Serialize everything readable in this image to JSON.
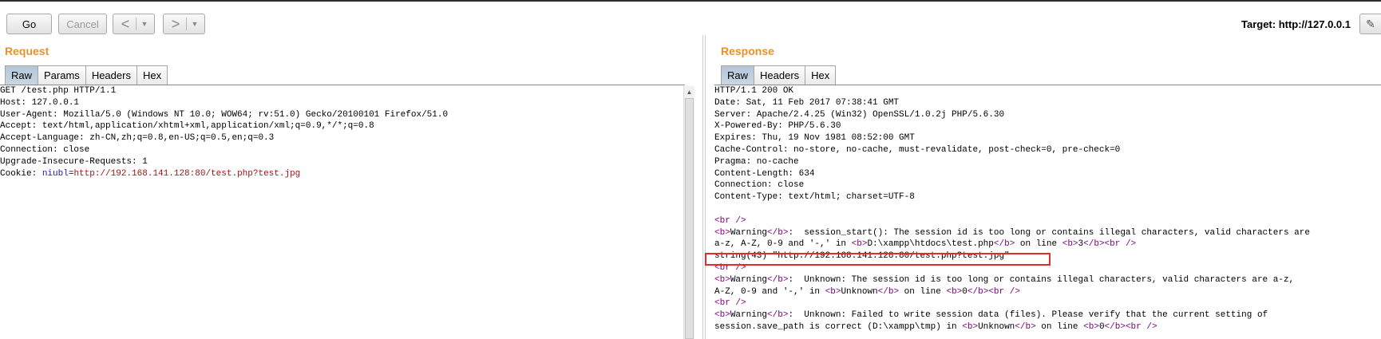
{
  "toolbar": {
    "go": "Go",
    "cancel": "Cancel",
    "back_arrow": "<",
    "forward_arrow": ">",
    "dropdown_arrow": "▼",
    "target_label": "Target: http://127.0.0.1"
  },
  "request": {
    "title": "Request",
    "tabs": [
      "Raw",
      "Params",
      "Headers",
      "Hex"
    ],
    "active_tab": "Raw",
    "lines": [
      "GET /test.php HTTP/1.1",
      "Host: 127.0.0.1",
      "User-Agent: Mozilla/5.0 (Windows NT 10.0; WOW64; rv:51.0) Gecko/20100101 Firefox/51.0",
      "Accept: text/html,application/xhtml+xml,application/xml;q=0.9,*/*;q=0.8",
      "Accept-Language: zh-CN,zh;q=0.8,en-US;q=0.5,en;q=0.3",
      "Connection: close",
      "Upgrade-Insecure-Requests: 1"
    ],
    "cookie": {
      "prefix": "Cookie: ",
      "name": "niubl",
      "eq": "=",
      "value": "http://192.168.141.128:80/test.php?test.jpg"
    }
  },
  "response": {
    "title": "Response",
    "tabs": [
      "Raw",
      "Headers",
      "Hex"
    ],
    "active_tab": "Raw",
    "headers": [
      "HTTP/1.1 200 OK",
      "Date: Sat, 11 Feb 2017 07:38:41 GMT",
      "Server: Apache/2.4.25 (Win32) OpenSSL/1.0.2j PHP/5.6.30",
      "X-Powered-By: PHP/5.6.30",
      "Expires: Thu, 19 Nov 1981 08:52:00 GMT",
      "Cache-Control: no-store, no-cache, must-revalidate, post-check=0, pre-check=0",
      "Pragma: no-cache",
      "Content-Length: 634",
      "Connection: close",
      "Content-Type: text/html; charset=UTF-8"
    ],
    "body": {
      "br": "<br />",
      "b_open": "<b>",
      "b_close": "</b>",
      "warning": "Warning",
      "colon_gap": ":  ",
      "w1_text": "session_start(): The session id is too long or contains illegal characters, valid characters are",
      "w1_line2_start": "a-z, A-Z, 0-9 and '-,' in ",
      "w1_path": "D:\\xampp\\htdocs\\test.php",
      "on_line": " on line ",
      "w1_line_no": "3",
      "br_tail": "<br />",
      "string_line": "string(43) \"http://192.168.141.128:80/test.php?test.jpg\"",
      "w2_text": "Unknown: The session id is too long or contains illegal characters, valid characters are a-z,",
      "w2_line2_start": "A-Z, 0-9 and '-,' in ",
      "unknown": "Unknown",
      "w2_line_no": "0",
      "w3_text": "Unknown: Failed to write session data (files). Please verify that the current setting of",
      "w3_line2_start": "session.save_path is correct (D:\\xampp\\tmp) in ",
      "w3_line_no": "0"
    }
  }
}
